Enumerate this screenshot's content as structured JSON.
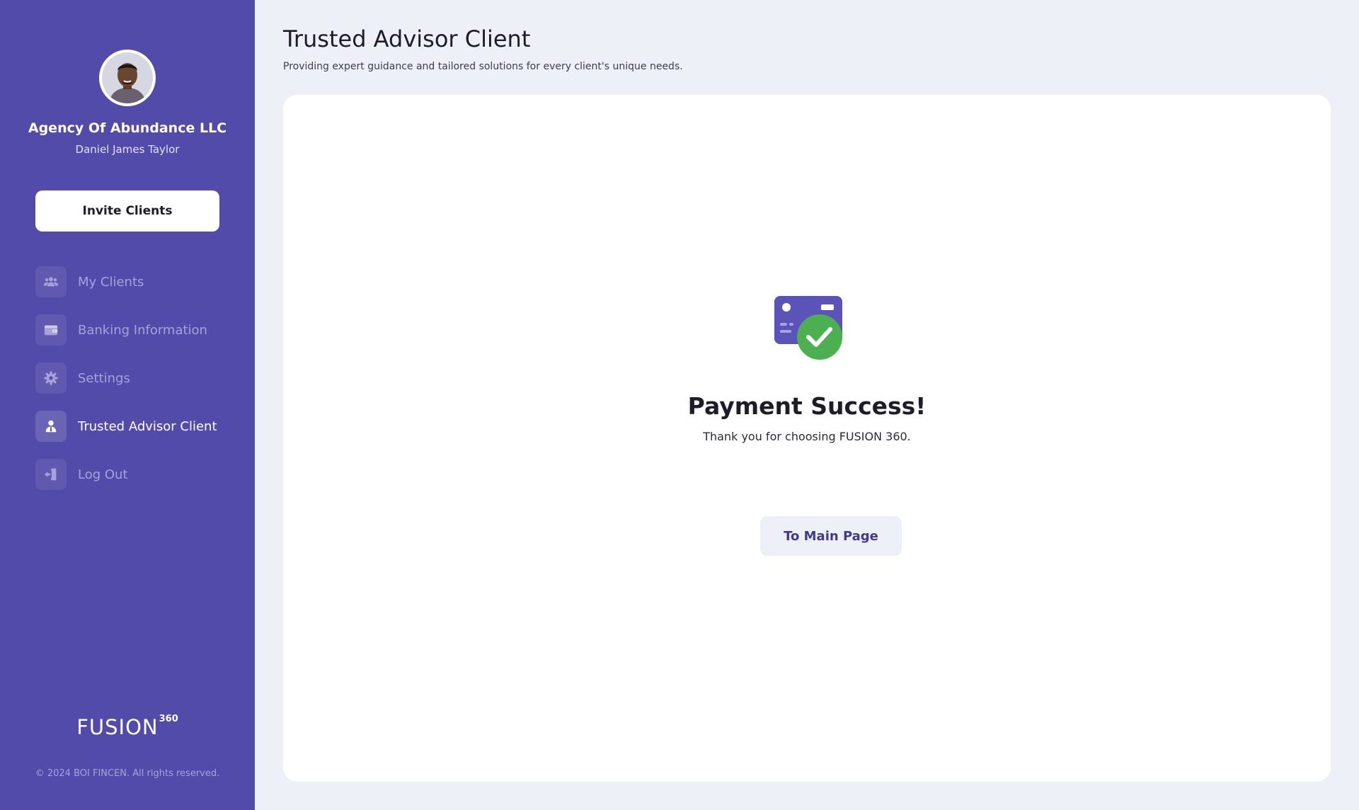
{
  "sidebar": {
    "org_name": "Agency Of Abundance LLC",
    "user_name": "Daniel James Taylor",
    "invite_label": "Invite Clients",
    "nav": [
      {
        "label": "My Clients",
        "icon": "users-icon",
        "active": false
      },
      {
        "label": "Banking Information",
        "icon": "wallet-icon",
        "active": false
      },
      {
        "label": "Settings",
        "icon": "gear-icon",
        "active": false
      },
      {
        "label": "Trusted Advisor Client",
        "icon": "user-tie-icon",
        "active": true
      },
      {
        "label": "Log Out",
        "icon": "logout-icon",
        "active": false
      }
    ],
    "brand": {
      "word": "FUSION",
      "superscript": "360"
    },
    "copyright": "© 2024 BOI FINCEN. All rights reserved."
  },
  "header": {
    "title": "Trusted Advisor Client",
    "subtitle": "Providing expert guidance and tailored solutions for every client's unique needs."
  },
  "card": {
    "icon": "payment-success-icon",
    "title": "Payment Success!",
    "message": "Thank you for choosing FUSION 360.",
    "button_label": "To Main Page"
  },
  "colors": {
    "sidebar_bg": "#534ba9",
    "accent": "#5b53b8",
    "success": "#4caf50",
    "page_bg": "#eef0f8"
  }
}
